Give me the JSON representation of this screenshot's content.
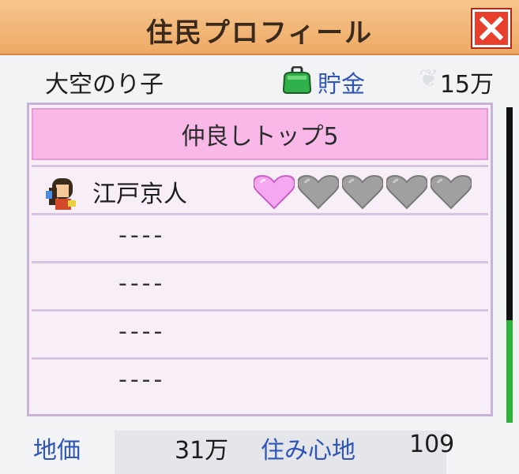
{
  "window": {
    "title": "住民プロフィール",
    "close_icon": "close-icon"
  },
  "resident": {
    "name": "大空のり子",
    "savings_label": "貯金",
    "savings_value": "15万",
    "wallet_icon": "coin-purse-icon"
  },
  "friends": {
    "header": "仲良しトップ5",
    "rows": [
      {
        "name": "江戸京人",
        "affinity_hearts": 1,
        "max_hearts": 5
      },
      {
        "name": "----"
      },
      {
        "name": "----"
      },
      {
        "name": "----"
      },
      {
        "name": "----"
      }
    ]
  },
  "stats": {
    "land_price_label": "地価",
    "land_price_value": "31万",
    "comfort_label": "住み心地",
    "comfort_value": "109"
  },
  "colors": {
    "title_bar": "#eeaa66",
    "close_button": "#e8402d",
    "label_blue": "#2f55b8",
    "panel_header": "#f9b9e8",
    "heart_filled": "#f5a8f0",
    "heart_empty": "#a0a0a0",
    "scroll_thumb": "#2fb23a"
  }
}
